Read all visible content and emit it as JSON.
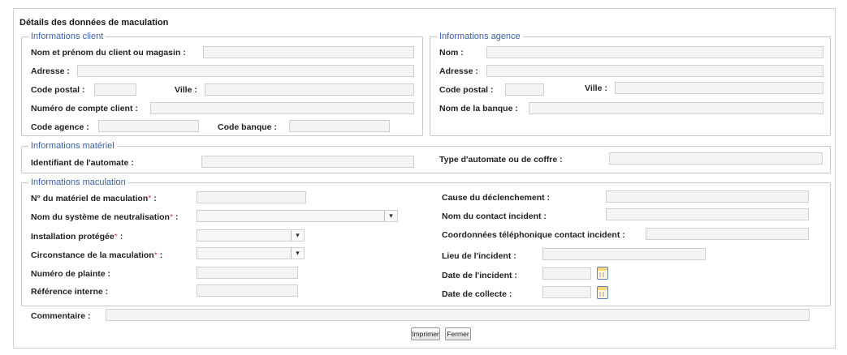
{
  "form": {
    "title": "Détails des données de maculation",
    "client": {
      "legend": "Informations client",
      "name_label": "Nom et prénom du client ou magasin :",
      "address_label": "Adresse :",
      "postal_label": "Code postal :",
      "city_label": "Ville :",
      "account_label": "Numéro de compte client :",
      "agency_code_label": "Code agence :",
      "bank_code_label": "Code banque :"
    },
    "agency": {
      "legend": "Informations agence",
      "name_label": "Nom :",
      "address_label": "Adresse :",
      "postal_label": "Code postal :",
      "city_label": "Ville :",
      "bank_label": "Nom de la banque :"
    },
    "material": {
      "legend": "Informations matériel",
      "automat_id_label": "Identifiant de l'automate :",
      "automat_type_label": "Type d'automate ou de coffre :"
    },
    "maculation": {
      "legend": "Informations maculation",
      "material_no_label": "N° du matériel de maculation",
      "neutralization_label": "Nom du système de neutralisation",
      "protected_install_label": "Installation protégée",
      "circumstance_label": "Circonstance de la maculation",
      "complaint_no_label": "Numéro de plainte :",
      "internal_ref_label": "Référence interne :",
      "trigger_cause_label": "Cause du déclenchement :",
      "incident_contact_label": "Nom du contact incident :",
      "incident_phone_label": "Coordonnées téléphonique contact incident :",
      "incident_place_label": "Lieu de l'incident :",
      "incident_date_label": "Date de l'incident :",
      "collect_date_label": "Date de collecte :"
    },
    "required_mark": "*",
    "colon": " :",
    "comment_label": "Commentaire :",
    "dropdown_arrow": "▾",
    "buttons": {
      "print": "Imprimer",
      "close": "Fermer"
    }
  },
  "colors": {
    "legend": "#3b5fa8",
    "required": "#e23a3a",
    "field_bg": "#f4f4f4"
  }
}
